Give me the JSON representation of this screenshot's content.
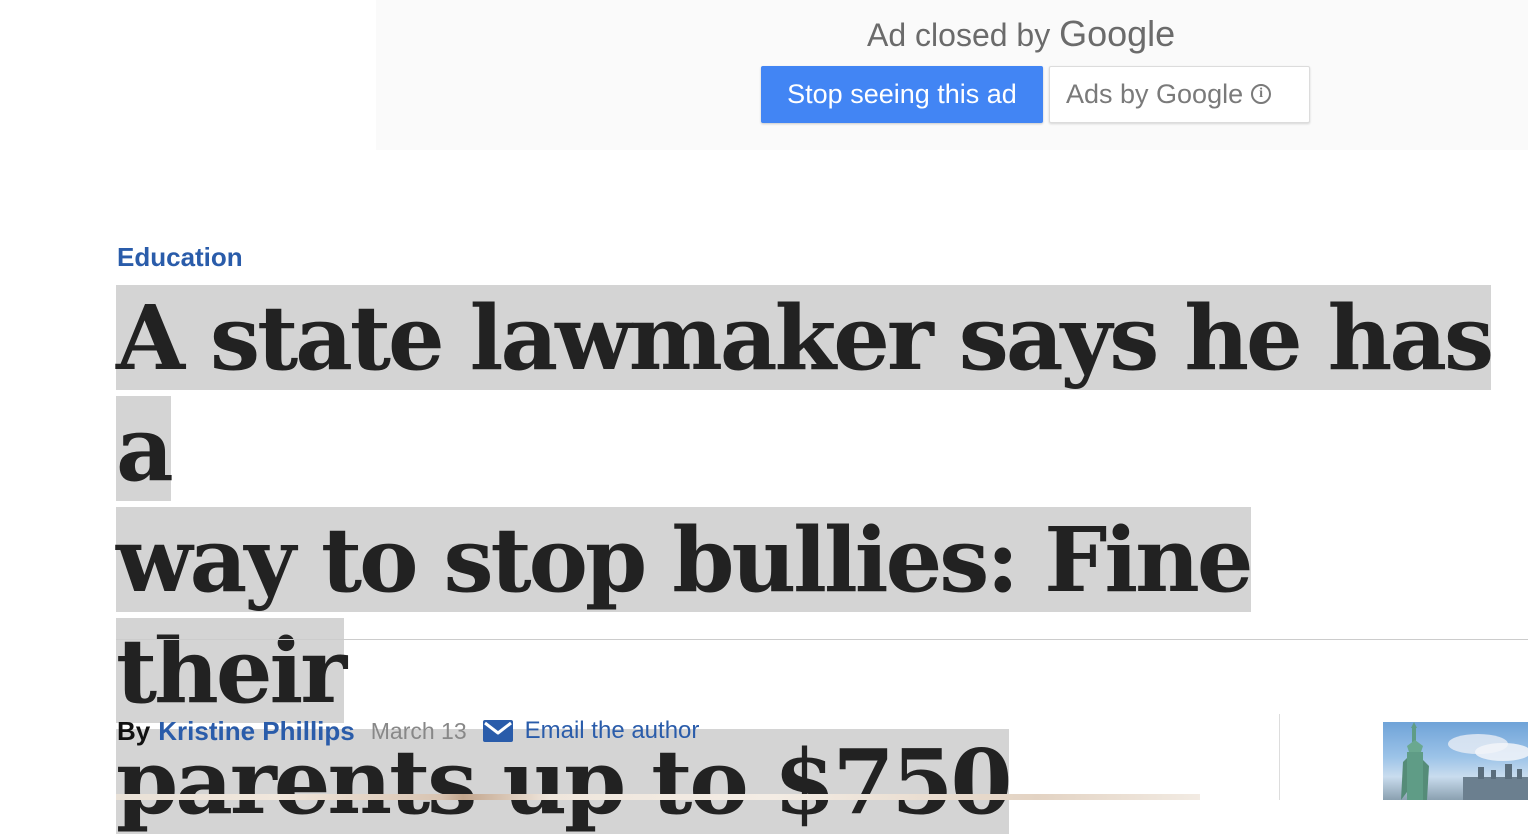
{
  "ad": {
    "closed_prefix": "Ad closed by",
    "closed_brand": "Google",
    "stop_button": "Stop seeing this ad",
    "ads_by_button": "Ads by Google",
    "info_glyph": "i"
  },
  "article": {
    "kicker": "Education",
    "headline_lines": [
      "A state lawmaker says he has a",
      "way to stop bullies: Fine their",
      "parents up to $750"
    ],
    "byline_prefix": "By",
    "author": "Kristine Phillips",
    "date": "March 13",
    "email_label": "Email the author"
  },
  "colors": {
    "link_blue": "#2a5caa",
    "google_blue": "#4285f4",
    "highlight_gray": "#d4d4d4",
    "headline_text": "#222222"
  },
  "icons": {
    "mail": "envelope-icon",
    "info": "info-circle-icon"
  }
}
